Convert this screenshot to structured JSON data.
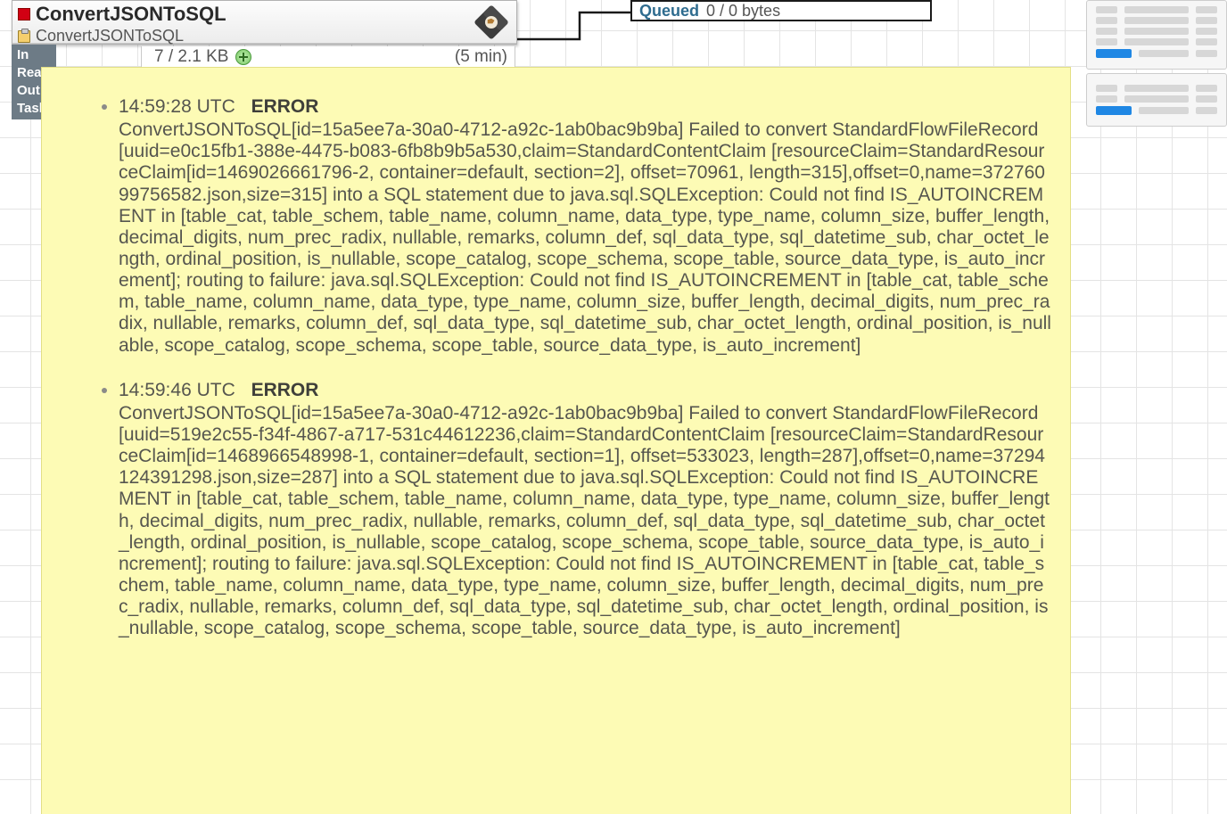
{
  "processor": {
    "title": "ConvertJSONToSQL",
    "subtitle": "ConvertJSONToSQL",
    "stat_labels": [
      "In",
      "Read",
      "Out",
      "Task"
    ],
    "stat_row": {
      "value": "7 / 2.1 KB",
      "interval": "(5 min)"
    }
  },
  "connection": {
    "queued_label": "Queued",
    "queued_value": "0 / 0 bytes"
  },
  "tooltip": {
    "entries": [
      {
        "time": "14:59:28 UTC",
        "level": "ERROR",
        "body": "ConvertJSONToSQL[id=15a5ee7a-30a0-4712-a92c-1ab0bac9b9ba] Failed to convert StandardFlowFileRecord[uuid=e0c15fb1-388e-4475-b083-6fb8b9b5a530,claim=StandardContentClaim [resourceClaim=StandardResourceClaim[id=1469026661796-2, container=default, section=2], offset=70961, length=315],offset=0,name=37276099756582.json,size=315] into a SQL statement due to java.sql.SQLException: Could not find IS_AUTOINCREMENT in [table_cat, table_schem, table_name, column_name, data_type, type_name, column_size, buffer_length, decimal_digits, num_prec_radix, nullable, remarks, column_def, sql_data_type, sql_datetime_sub, char_octet_length, ordinal_position, is_nullable, scope_catalog, scope_schema, scope_table, source_data_type, is_auto_increment]; routing to failure: java.sql.SQLException: Could not find IS_AUTOINCREMENT in [table_cat, table_schem, table_name, column_name, data_type, type_name, column_size, buffer_length, decimal_digits, num_prec_radix, nullable, remarks, column_def, sql_data_type, sql_datetime_sub, char_octet_length, ordinal_position, is_nullable, scope_catalog, scope_schema, scope_table, source_data_type, is_auto_increment]"
      },
      {
        "time": "14:59:46 UTC",
        "level": "ERROR",
        "body": "ConvertJSONToSQL[id=15a5ee7a-30a0-4712-a92c-1ab0bac9b9ba] Failed to convert StandardFlowFileRecord[uuid=519e2c55-f34f-4867-a717-531c44612236,claim=StandardContentClaim [resourceClaim=StandardResourceClaim[id=1468966548998-1, container=default, section=1], offset=533023, length=287],offset=0,name=37294124391298.json,size=287] into a SQL statement due to java.sql.SQLException: Could not find IS_AUTOINCREMENT in [table_cat, table_schem, table_name, column_name, data_type, type_name, column_size, buffer_length, decimal_digits, num_prec_radix, nullable, remarks, column_def, sql_data_type, sql_datetime_sub, char_octet_length, ordinal_position, is_nullable, scope_catalog, scope_schema, scope_table, source_data_type, is_auto_increment]; routing to failure: java.sql.SQLException: Could not find IS_AUTOINCREMENT in [table_cat, table_schem, table_name, column_name, data_type, type_name, column_size, buffer_length, decimal_digits, num_prec_radix, nullable, remarks, column_def, sql_data_type, sql_datetime_sub, char_octet_length, ordinal_position, is_nullable, scope_catalog, scope_schema, scope_table, source_data_type, is_auto_increment]"
      }
    ]
  }
}
